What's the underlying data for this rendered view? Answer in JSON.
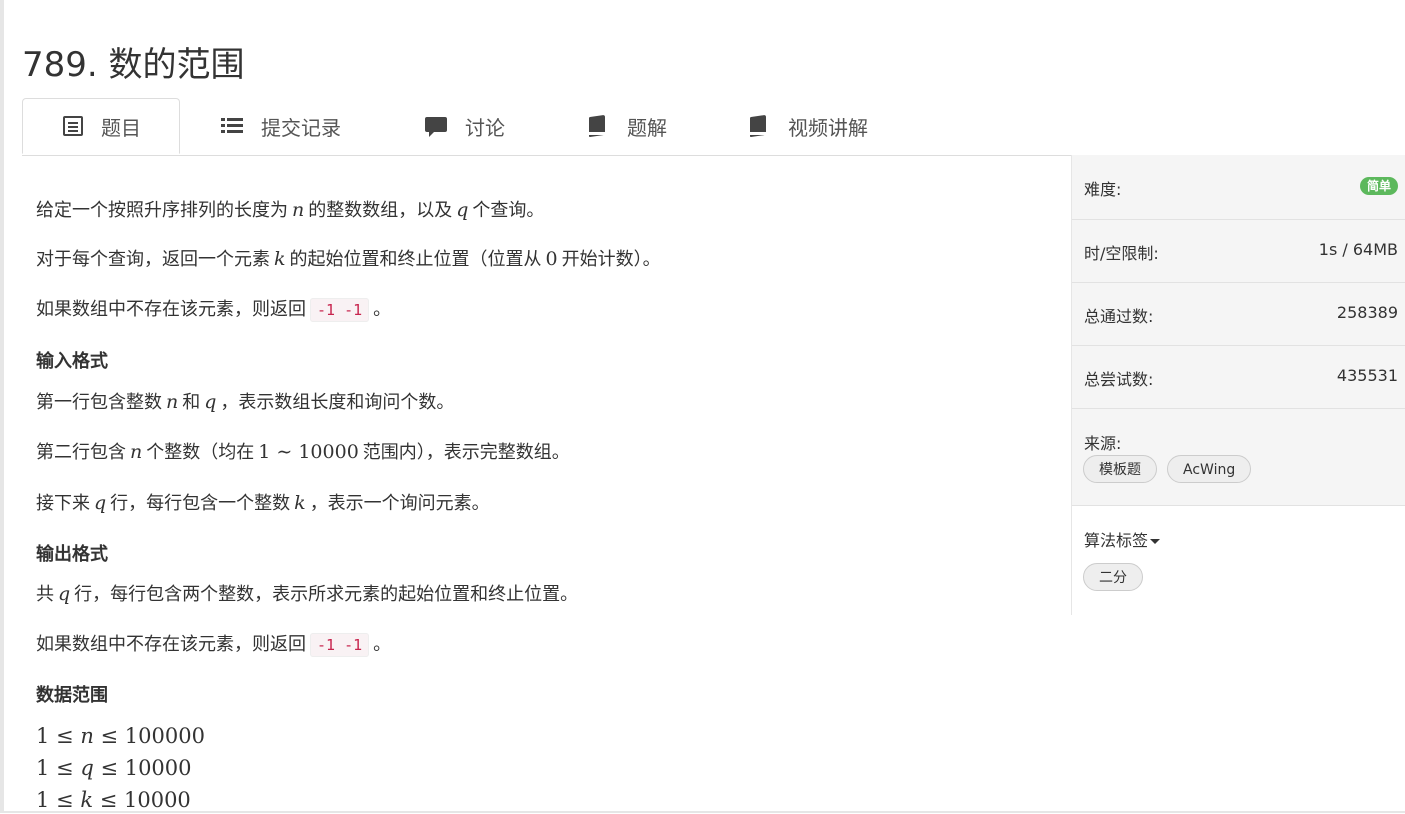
{
  "problem": {
    "title": "789. 数的范围"
  },
  "tabs": [
    {
      "label": "题目",
      "icon": "document-icon"
    },
    {
      "label": "提交记录",
      "icon": "list-icon"
    },
    {
      "label": "讨论",
      "icon": "chat-icon"
    },
    {
      "label": "题解",
      "icon": "book-icon"
    },
    {
      "label": "视频讲解",
      "icon": "book-icon"
    }
  ],
  "statement": {
    "p1": {
      "a": "给定一个按照升序排列的长度为",
      "n": "n",
      "b": "的整数数组，以及",
      "q": "q",
      "c": "个查询。"
    },
    "p2": {
      "a": "对于每个查询，返回一个元素",
      "k": "k",
      "b": "的起始位置和终止位置（位置从",
      "zero": "0",
      "c": "开始计数）。"
    },
    "p3": {
      "a": "如果数组中不存在该元素，则返回",
      "code": "-1 -1",
      "b": "。"
    },
    "input_heading": "输入格式",
    "p4": {
      "a": "第一行包含整数",
      "n": "n",
      "b": "和",
      "q": "q",
      "c": "，表示数组长度和询问个数。"
    },
    "p5": {
      "a": "第二行包含",
      "n": "n",
      "b": "个整数（均在",
      "range": "1 ∼ 10000",
      "c": "范围内），表示完整数组。"
    },
    "p6": {
      "a": "接下来",
      "q": "q",
      "b": "行，每行包含一个整数",
      "k": "k",
      "c": "，表示一个询问元素。"
    },
    "output_heading": "输出格式",
    "p7": {
      "a": "共",
      "q": "q",
      "b": "行，每行包含两个整数，表示所求元素的起始位置和终止位置。"
    },
    "p8": {
      "a": "如果数组中不存在该元素，则返回",
      "code": "-1 -1",
      "b": "。"
    },
    "range_heading": "数据范围",
    "ranges": [
      {
        "lo": "1 ≤ ",
        "var": "n",
        "hi": " ≤ 100000"
      },
      {
        "lo": "1 ≤ ",
        "var": "q",
        "hi": " ≤ 10000"
      },
      {
        "lo": "1 ≤ ",
        "var": "k",
        "hi": " ≤ 10000"
      }
    ]
  },
  "sidebar": {
    "difficulty_label": "难度:",
    "difficulty_value": "简单",
    "limit_label": "时/空限制:",
    "limit_value": "1s / 64MB",
    "accepted_label": "总通过数:",
    "accepted_value": "258389",
    "attempts_label": "总尝试数:",
    "attempts_value": "435531",
    "source_label": "来源:",
    "source_tags": [
      "模板题",
      "AcWing"
    ],
    "algo_label": "算法标签",
    "algo_tags": [
      "二分"
    ]
  },
  "colors": {
    "easy_badge": "#5cb85c",
    "code_text": "#c7254e",
    "sidebar_bg": "#f5f5f5"
  }
}
